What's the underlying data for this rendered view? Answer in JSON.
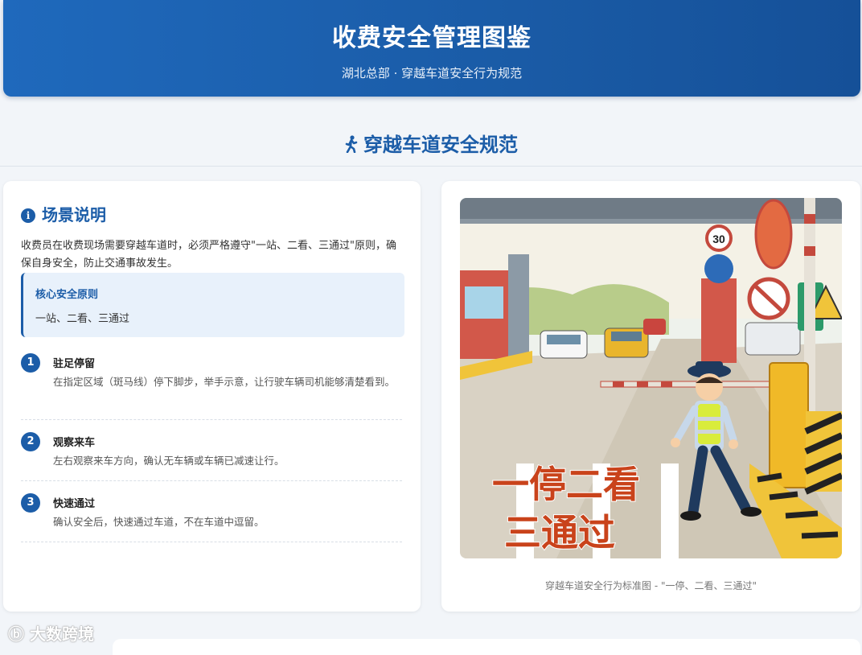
{
  "header": {
    "title": "收费安全管理图鉴",
    "subtitle": "湖北总部 · 穿越车道安全行为规范"
  },
  "section": {
    "title": "穿越车道安全规范",
    "icon": "walking-person-icon"
  },
  "scene": {
    "title": "场景说明",
    "icon": "info-icon",
    "description": "收费员在收费现场需要穿越车道时，必须严格遵守\"一站、二看、三通过\"原则，确保自身安全，防止交通事故发生。",
    "principle_title": "核心安全原则",
    "principle_value": "一站、二看、三通过",
    "steps": [
      {
        "num": "1",
        "title": "驻足停留",
        "desc": "在指定区域（斑马线）停下脚步，举手示意，让行驶车辆司机能够清楚看到。"
      },
      {
        "num": "2",
        "title": "观察来车",
        "desc": "左右观察来车方向，确认无车辆或车辆已减速让行。"
      },
      {
        "num": "3",
        "title": "快速通过",
        "desc": "确认安全后，快速通过车道，不在车道中逗留。"
      }
    ]
  },
  "illustration": {
    "overlay_line1": "一停二看",
    "overlay_line2": "三通过",
    "sign_speed": "30",
    "caption": "穿越车道安全行为标准图 - \"一停、二看、三通过\""
  },
  "watermark": "大数跨境",
  "colors": {
    "primary": "#1c5da8",
    "header_gradient_start": "#1f69bc",
    "header_gradient_end": "#155098",
    "highlight_bg": "#e8f1fb",
    "overlay_text": "#c9431b"
  }
}
